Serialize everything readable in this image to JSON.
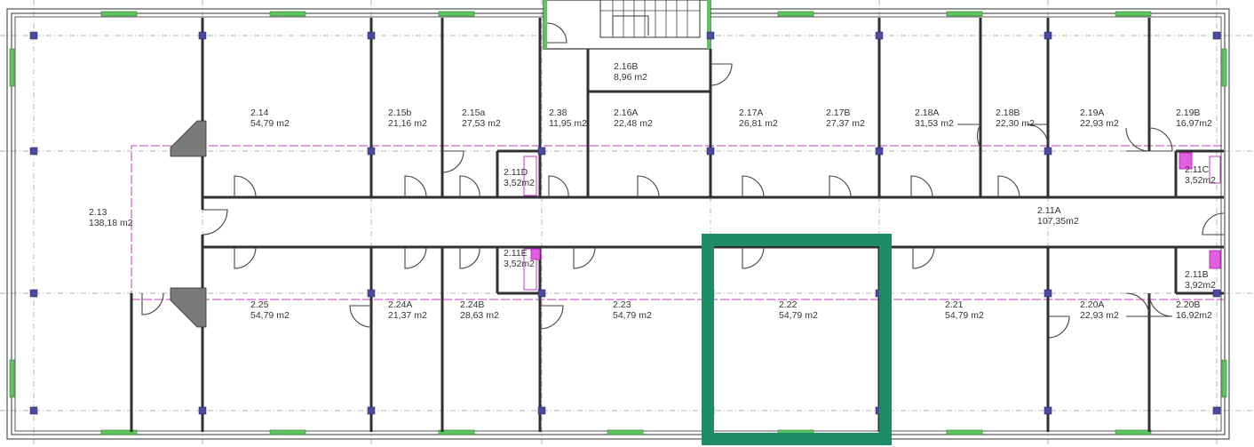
{
  "plan": {
    "colors": {
      "wall": "#303030",
      "wall_fill": "#ffffff",
      "grid": "#9a9a9a",
      "pink_line": "#c040c0",
      "column": "#4a4aa0",
      "door": "#404040",
      "window": "#5ec45e",
      "highlight": "#1e8c64",
      "text": "#333333"
    },
    "rooms": [
      {
        "id": "2.13",
        "area": "138,18 m2"
      },
      {
        "id": "2.14",
        "area": "54,79 m2"
      },
      {
        "id": "2.15b",
        "area": "21,16 m2"
      },
      {
        "id": "2.15a",
        "area": "27,53 m2"
      },
      {
        "id": "2.38",
        "area": "11,95 m2"
      },
      {
        "id": "2.16B",
        "area": "8,96 m2"
      },
      {
        "id": "2.16A",
        "area": "22,48 m2"
      },
      {
        "id": "2.17A",
        "area": "26,81 m2"
      },
      {
        "id": "2.17B",
        "area": "27,37 m2"
      },
      {
        "id": "2.18A",
        "area": "31,53 m2"
      },
      {
        "id": "2.18B",
        "area": "22,30 m2"
      },
      {
        "id": "2.19A",
        "area": "22,93 m2"
      },
      {
        "id": "2.19B",
        "area": "16,97m2"
      },
      {
        "id": "2.11D",
        "area": "3,52m2"
      },
      {
        "id": "2.11C",
        "area": "3,52m2"
      },
      {
        "id": "2.11A",
        "area": "107,35m2"
      },
      {
        "id": "2.11E",
        "area": "3,52m2"
      },
      {
        "id": "2.11B",
        "area": "3,92m2"
      },
      {
        "id": "2.25",
        "area": "54,79 m2"
      },
      {
        "id": "2.24A",
        "area": "21,37 m2"
      },
      {
        "id": "2.24B",
        "area": "28,63 m2"
      },
      {
        "id": "2.23",
        "area": "54,79 m2"
      },
      {
        "id": "2.22",
        "area": "54,79 m2"
      },
      {
        "id": "2.21",
        "area": "54,79 m2"
      },
      {
        "id": "2.20A",
        "area": "22,93 m2"
      },
      {
        "id": "2.20B",
        "area": "16,92m2"
      }
    ],
    "selected_room": "2.22"
  }
}
